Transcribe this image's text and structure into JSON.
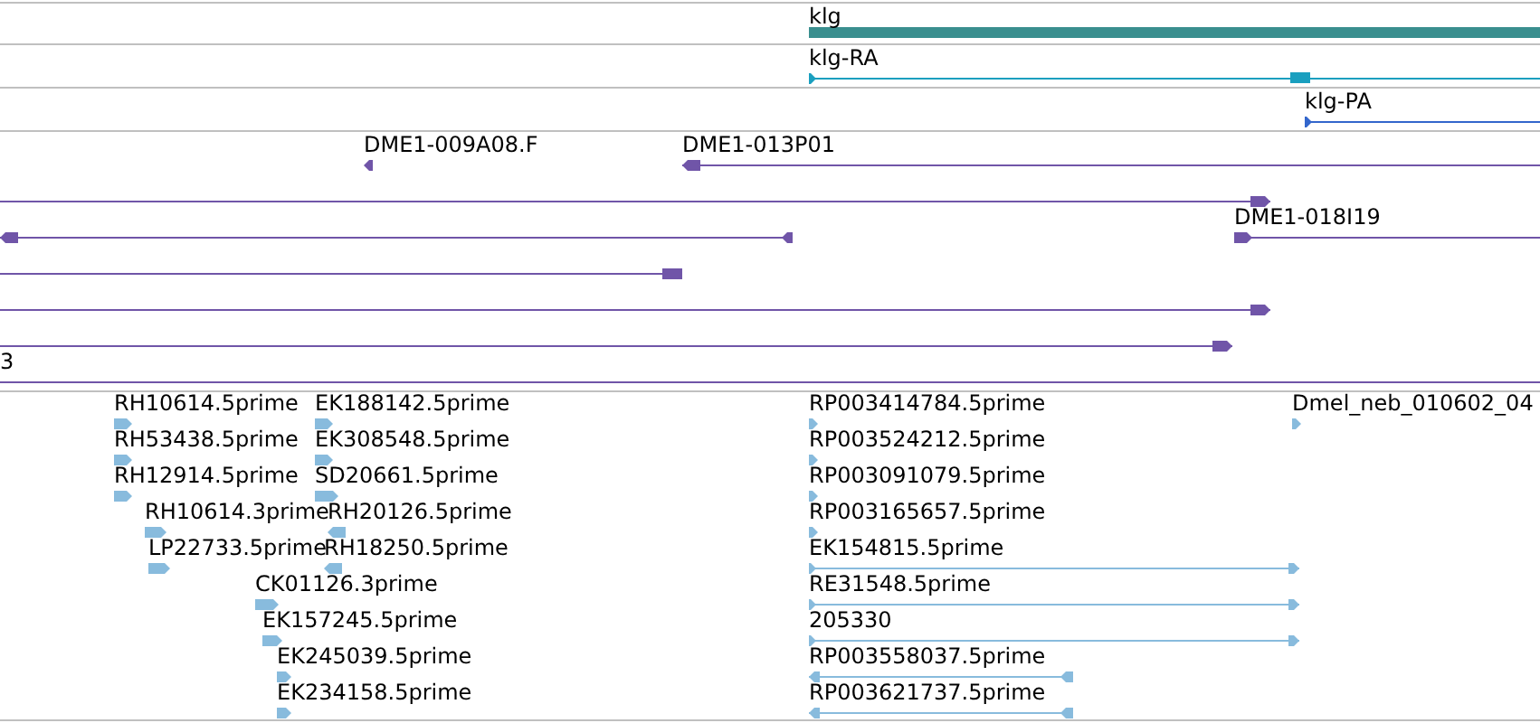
{
  "tracks": [
    {
      "kind": "gene",
      "features": [
        {
          "label": "klg"
        }
      ]
    },
    {
      "kind": "transcript",
      "features": [
        {
          "label": "klg-RA",
          "reverse": false,
          "color": "#1a9fbf"
        }
      ]
    },
    {
      "kind": "transcript",
      "features": [
        {
          "label": "klg-PA",
          "reverse": false,
          "color": "#3366cc"
        }
      ]
    },
    {
      "kind": "clone",
      "features": [
        {
          "label": "DME1-009A08.F",
          "reverse": true
        },
        {
          "label": "DME1-013P01",
          "reverse": true
        },
        {
          "reverse": false
        },
        {
          "reverse": true
        },
        {
          "label": "DME1-018I19",
          "reverse": false
        },
        {
          "reverse": false
        },
        {
          "reverse": false
        },
        {
          "reverse": false
        },
        {
          "label": "3"
        }
      ]
    },
    {
      "kind": "est",
      "features": [
        {
          "label": "RH10614.5prime",
          "reverse": false
        },
        {
          "label": "EK188142.5prime",
          "reverse": false
        },
        {
          "label": "RP003414784.5prime",
          "reverse": false
        },
        {
          "label": "Dmel_neb_010602_04",
          "reverse": false
        },
        {
          "label": "RH53438.5prime",
          "reverse": false
        },
        {
          "label": "EK308548.5prime",
          "reverse": false
        },
        {
          "label": "RP003524212.5prime",
          "reverse": false
        },
        {
          "label": "RH12914.5prime",
          "reverse": false
        },
        {
          "label": "SD20661.5prime",
          "reverse": false
        },
        {
          "label": "RP003091079.5prime",
          "reverse": false
        },
        {
          "label": "RH10614.3prime",
          "reverse": false
        },
        {
          "label": "RH20126.5prime",
          "reverse": true
        },
        {
          "label": "RP003165657.5prime",
          "reverse": false
        },
        {
          "label": "LP22733.5prime",
          "reverse": false
        },
        {
          "label": "RH18250.5prime",
          "reverse": true
        },
        {
          "label": "EK154815.5prime",
          "reverse": false
        },
        {
          "label": "CK01126.3prime",
          "reverse": false
        },
        {
          "label": "RE31548.5prime",
          "reverse": false
        },
        {
          "label": "EK157245.5prime",
          "reverse": false
        },
        {
          "label": "205330",
          "reverse": false
        },
        {
          "label": "EK245039.5prime",
          "reverse": false
        },
        {
          "label": "RP003558037.5prime",
          "reverse": true
        },
        {
          "label": "EK234158.5prime",
          "reverse": false
        },
        {
          "label": "RP003621737.5prime",
          "reverse": true
        }
      ]
    }
  ]
}
